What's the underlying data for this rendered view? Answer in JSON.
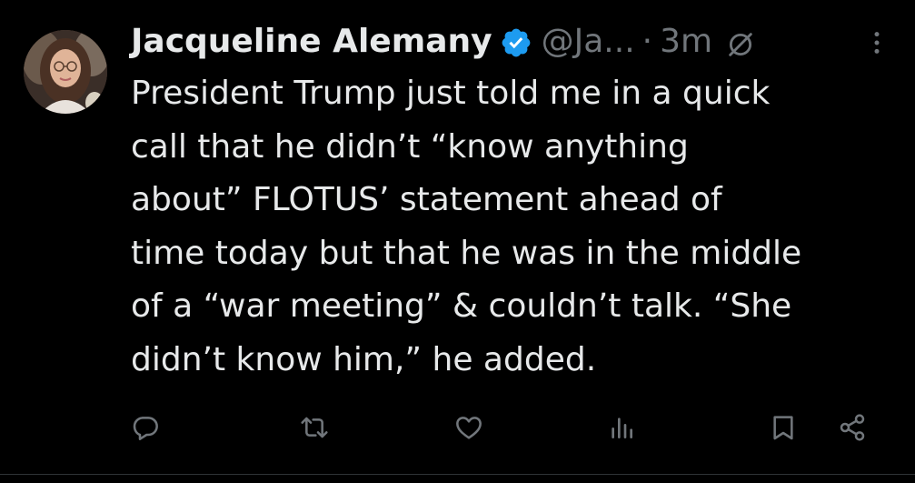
{
  "tweet": {
    "author_name": "Jacqueline Alemany",
    "handle": "@Ja...",
    "separator": "·",
    "time": "3m",
    "text": "President Trump just told me in a quick\ncall that he didn’t “know anything\nabout” FLOTUS’ statement ahead of\ntime today but that he was in the middle\nof a “war meeting” & couldn’t talk. “She\ndidn’t know him,” he added."
  },
  "icons": {
    "verified": "verified-badge-icon",
    "no_reply": "no-reply-icon",
    "more": "more-options-icon",
    "reply": "reply-icon",
    "retweet": "retweet-icon",
    "like": "like-icon",
    "views": "views-icon",
    "bookmark": "bookmark-icon",
    "share": "share-icon"
  },
  "colors": {
    "background": "#000000",
    "text": "#e7e9ea",
    "secondary": "#71767b",
    "verified": "#1d9bf0"
  }
}
